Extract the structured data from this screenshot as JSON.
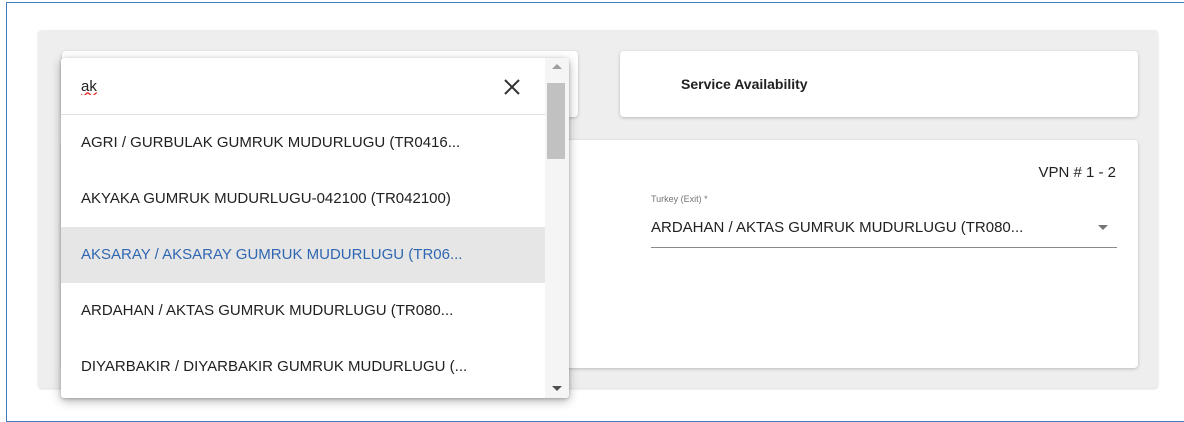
{
  "search": {
    "value": "ak"
  },
  "dropdown": {
    "options": [
      "AGRI / GURBULAK GUMRUK MUDURLUGU (TR0416...",
      "AKYAKA GUMRUK MUDURLUGU-042100 (TR042100)",
      "AKSARAY / AKSARAY GUMRUK MUDURLUGU (TR06...",
      "ARDAHAN / AKTAS GUMRUK MUDURLUGU (TR080...",
      "DIYARBAKIR / DIYARBAKIR GUMRUK MUDURLUGU (..."
    ],
    "highlighted_index": 2
  },
  "service_card": {
    "label": "Service Availability"
  },
  "main_card": {
    "vpn_label": "VPN # 1 - 2",
    "exit_field": {
      "caption": "Turkey (Exit) *",
      "value": "ARDAHAN / AKTAS GUMRUK MUDURLUGU (TR080..."
    }
  },
  "icons": {
    "clear": "close-icon",
    "field_arrow": "chevron-down-icon"
  },
  "colors": {
    "highlight_text": "#2f67b2",
    "highlight_bg": "#e6e6e6",
    "frame_border": "#3f7fbf"
  }
}
